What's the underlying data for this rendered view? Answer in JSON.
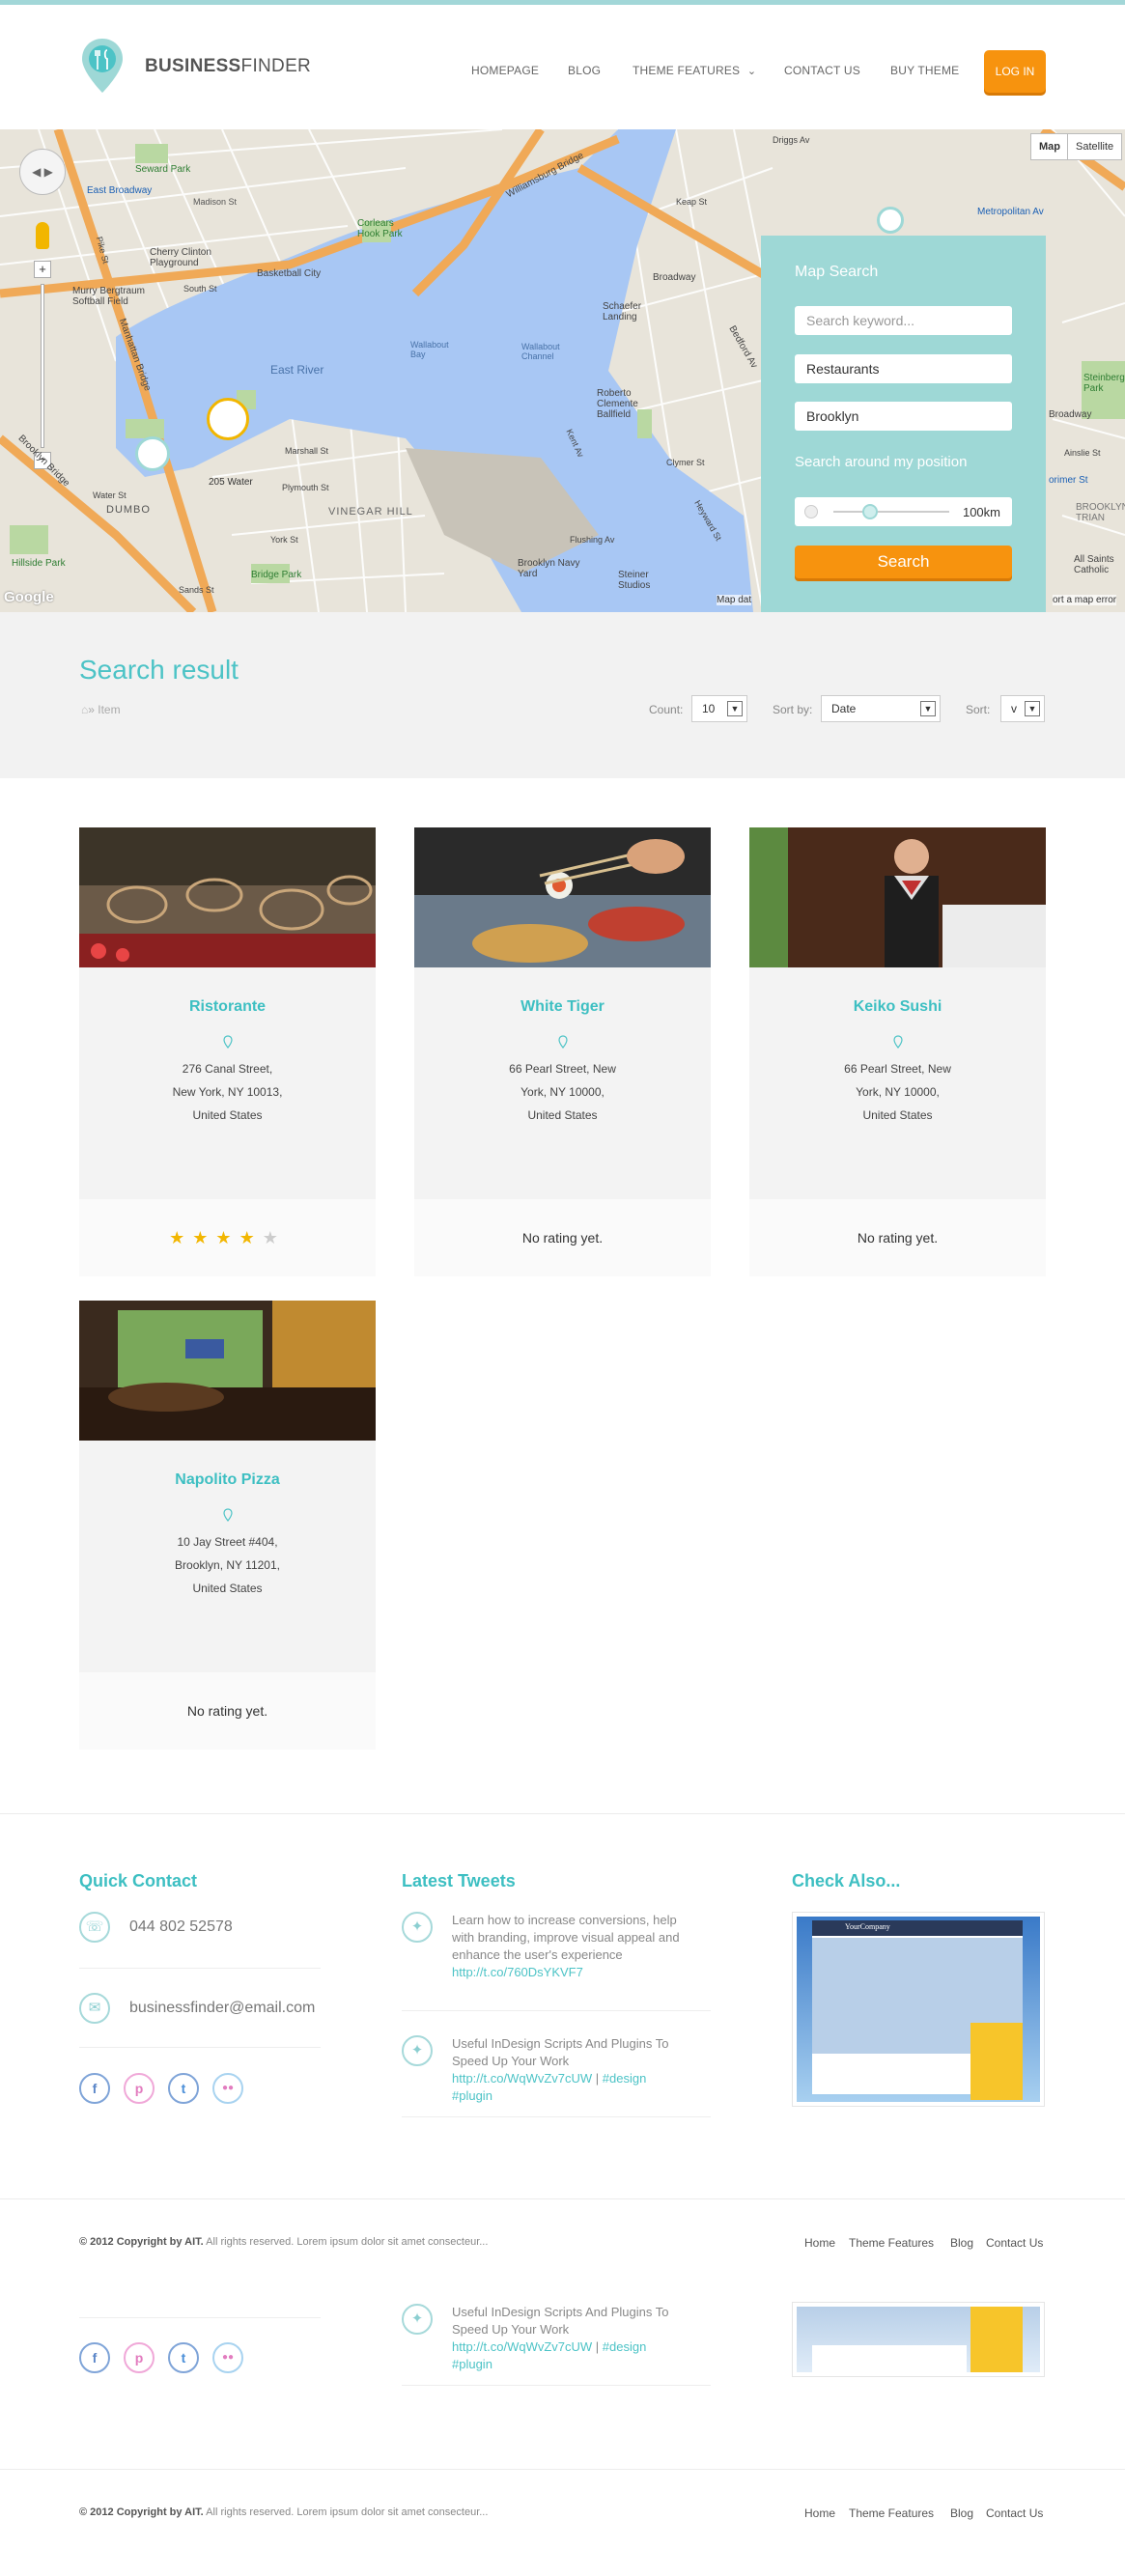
{
  "brand": {
    "bold": "BUSINESS",
    "light": "FINDER"
  },
  "nav": {
    "items": [
      "HOMEPAGE",
      "BLOG",
      "THEME FEATURES",
      "CONTACT US",
      "BUY THEME"
    ],
    "login": "LOG IN"
  },
  "map": {
    "type_buttons": [
      "Map",
      "Satellite"
    ],
    "attribution": "Map dat",
    "report": "ort a map error",
    "google": "Google",
    "labels": [
      "Seward Park",
      "East Broadway",
      "Madison St",
      "Cherry Clinton Playground",
      "Corlears Hook Park",
      "Murry Bergtraum Softball Field",
      "Basketball City",
      "South St",
      "Williamsburg Bridge",
      "East River",
      "Wallabout Bay",
      "Manhattan Bridge",
      "Brooklyn Bridge",
      "Pike St",
      "Water St",
      "DUMBO",
      "205 Water",
      "Marshall St",
      "Plymouth St",
      "VINEGAR HILL",
      "York St",
      "Hillside Park",
      "Sands St",
      "Bridge Park",
      "Brooklyn Navy Yard",
      "Steiner Studios",
      "Roberto Clemente Ballfield",
      "Schaefer Landing",
      "Broadway",
      "Metropolitan Av",
      "Bedford Av",
      "Driggs Av",
      "Keap St",
      "Wallabout Channel",
      "Flushing Av",
      "Kent Av",
      "Clymer St",
      "Heyward St",
      "Broadway",
      "Steinberg Park",
      "Ainslie St",
      "All Saints Catholic",
      "orimer St",
      "BROOKLYN TRIAN"
    ]
  },
  "search_panel": {
    "title": "Map Search",
    "keyword_placeholder": "Search keyword...",
    "category": "Restaurants",
    "location": "Brooklyn",
    "around_label": "Search around my position",
    "radius": "100km",
    "search_label": "Search"
  },
  "results": {
    "title": "Search result",
    "breadcrumb": "» Item",
    "count_label": "Count:",
    "count_value": "10",
    "sortby_label": "Sort by:",
    "sortby_value": "Date",
    "sort_label": "Sort:",
    "sort_value": "v"
  },
  "cards": [
    {
      "name": "Ristorante",
      "addr": [
        "276 Canal Street,",
        "New York, NY 10013,",
        "United States"
      ],
      "rating": 4,
      "rating_text": ""
    },
    {
      "name": "White Tiger",
      "addr": [
        "66 Pearl Street, New",
        "York, NY 10000,",
        "United States"
      ],
      "rating": 0,
      "rating_text": "No rating yet."
    },
    {
      "name": "Keiko Sushi",
      "addr": [
        "66 Pearl Street, New",
        "York, NY 10000,",
        "United States"
      ],
      "rating": 0,
      "rating_text": "No rating yet."
    },
    {
      "name": "Napolito Pizza",
      "addr": [
        "10 Jay Street #404,",
        "Brooklyn, NY 11201,",
        "United States"
      ],
      "rating": 0,
      "rating_text": "No rating yet."
    }
  ],
  "footer": {
    "quick_contact": "Quick Contact",
    "phone": "044 802 52578",
    "email": "businessfinder@email.com",
    "latest_tweets": "Latest Tweets",
    "tweet1": {
      "text": "Learn how to increase conversions, help with branding, improve visual appeal and enhance the user's experience ",
      "link": "http://t.co/760DsYKVF7"
    },
    "tweet2": {
      "text": "Useful InDesign Scripts And Plugins To Speed Up Your Work ",
      "link": "http://t.co/WqWvZv7cUW",
      "sep": " | ",
      "tag1": "#design",
      "tag2": "#plugin"
    },
    "check_also": "Check Also...",
    "thumb_logo": "YourCompany",
    "copyright_bold": "© 2012 Copyright by AIT.",
    "copyright_rest": " All rights reserved. Lorem ipsum dolor sit amet consecteur...",
    "links": [
      "Home",
      "Theme Features",
      "Blog",
      "Contact Us"
    ]
  },
  "colors": {
    "accent": "#4cc3c6",
    "orange": "#f7930e",
    "panel": "#9ed8d6"
  }
}
